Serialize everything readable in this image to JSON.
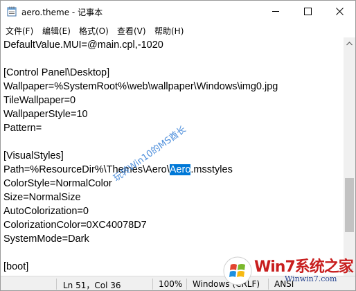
{
  "window": {
    "title": "aero.theme - 记事本"
  },
  "menu": {
    "items": [
      "文件(F)",
      "编辑(E)",
      "格式(O)",
      "查看(V)",
      "帮助(H)"
    ]
  },
  "editor": {
    "lines": [
      "DefaultValue.MUI=@main.cpl,-1020",
      "",
      "[Control Panel\\Desktop]",
      "Wallpaper=%SystemRoot%\\web\\wallpaper\\Windows\\img0.jpg",
      "TileWallpaper=0",
      "WallpaperStyle=10",
      "Pattern=",
      "",
      "[VisualStyles]",
      "",
      "ColorStyle=NormalColor",
      "Size=NormalSize",
      "AutoColorization=0",
      "ColorizationColor=0XC40078D7",
      "SystemMode=Dark",
      "",
      "[boot]"
    ],
    "selected_line": {
      "before": "Path=%ResourceDir%\\Themes\\Aero\\",
      "selected": "Aero",
      "after": ".msstyles"
    },
    "watermark": "玩转Win10的MS酋长"
  },
  "status": {
    "position": "Ln 51，Col 36",
    "zoom": "100%",
    "line_ending": "Windows (CRLF)",
    "encoding": "ANSI"
  },
  "logo": {
    "brand": "Win7系统之家",
    "url": "Winwin7.com"
  },
  "colors": {
    "selection": "#0078d7",
    "logo_red": "#c81e1e",
    "logo_blue": "#1f3d8a"
  }
}
